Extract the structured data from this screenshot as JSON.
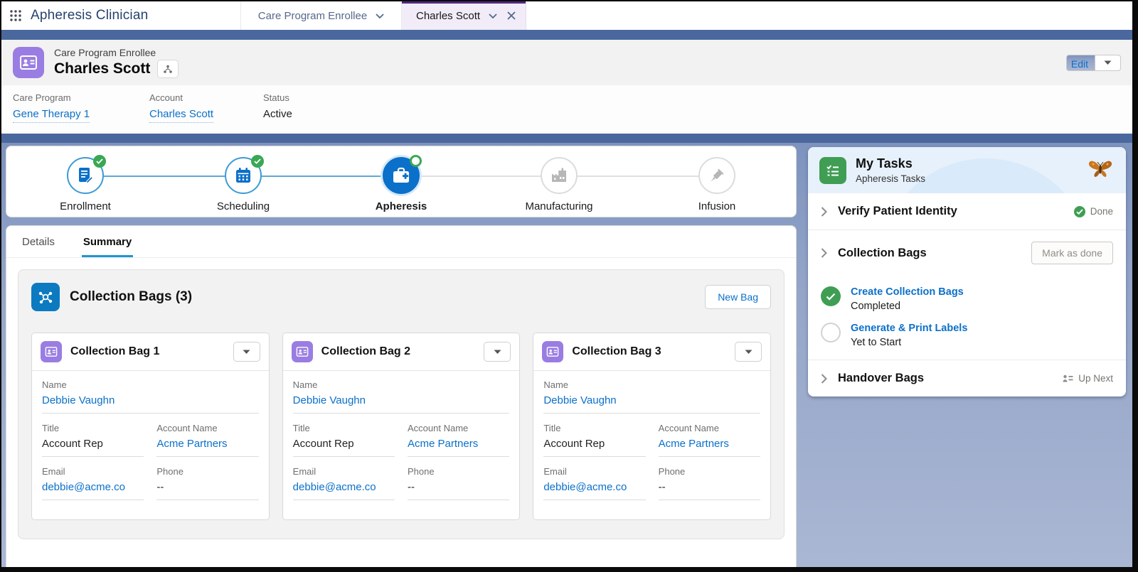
{
  "app": {
    "name": "Apheresis Clinician"
  },
  "nav": {
    "object_tab": "Care Program Enrollee",
    "record_tab": "Charles Scott"
  },
  "header": {
    "entity": "Care Program Enrollee",
    "record_name": "Charles Scott",
    "edit_button": "Edit",
    "fields": [
      {
        "label": "Care Program",
        "value": "Gene Therapy 1"
      },
      {
        "label": "Account",
        "value": "Charles Scott"
      },
      {
        "label": "Status",
        "value": "Active"
      }
    ]
  },
  "path": {
    "stages": [
      {
        "label": "Enrollment",
        "state": "complete",
        "icon": "document-icon"
      },
      {
        "label": "Scheduling",
        "state": "complete",
        "icon": "calendar-icon"
      },
      {
        "label": "Apheresis",
        "state": "current",
        "icon": "first-aid-icon"
      },
      {
        "label": "Manufacturing",
        "state": "upcoming",
        "icon": "factory-icon"
      },
      {
        "label": "Infusion",
        "state": "upcoming",
        "icon": "syringe-icon"
      }
    ]
  },
  "tabs": [
    {
      "label": "Details",
      "active": false
    },
    {
      "label": "Summary",
      "active": true
    }
  ],
  "collection_bags": {
    "title": "Collection Bags (3)",
    "new_bag_button": "New Bag",
    "cards": [
      {
        "title": "Collection Bag 1",
        "name_label": "Name",
        "name": "Debbie Vaughn",
        "title_label": "Title",
        "title_value": "Account Rep",
        "account_label": "Account Name",
        "account": "Acme Partners",
        "email_label": "Email",
        "email": "debbie@acme.co",
        "phone_label": "Phone",
        "phone": "--"
      },
      {
        "title": "Collection Bag 2",
        "name_label": "Name",
        "name": "Debbie Vaughn",
        "title_label": "Title",
        "title_value": "Account Rep",
        "account_label": "Account Name",
        "account": "Acme Partners",
        "email_label": "Email",
        "email": "debbie@acme.co",
        "phone_label": "Phone",
        "phone": "--"
      },
      {
        "title": "Collection Bag 3",
        "name_label": "Name",
        "name": "Debbie Vaughn",
        "title_label": "Title",
        "title_value": "Account Rep",
        "account_label": "Account Name",
        "account": "Acme Partners",
        "email_label": "Email",
        "email": "debbie@acme.co",
        "phone_label": "Phone",
        "phone": "--"
      }
    ]
  },
  "tasks": {
    "title": "My Tasks",
    "subtitle": "Apheresis Tasks",
    "verify": {
      "label": "Verify Patient Identity",
      "status": "Done"
    },
    "collection": {
      "label": "Collection Bags",
      "action": "Mark as done",
      "items": [
        {
          "label": "Create Collection Bags",
          "status": "Completed",
          "state": "complete"
        },
        {
          "label": "Generate & Print Labels",
          "status": "Yet to Start",
          "state": "open"
        }
      ]
    },
    "handover": {
      "label": "Handover Bags",
      "status": "Up Next"
    }
  },
  "colors": {
    "brand_navy": "#25426e",
    "band_blue": "#4a689d",
    "link_blue": "#0b70c9",
    "path_blue": "#0b70c9",
    "success_green": "#3f9e53",
    "accent_purple": "#9a7de2",
    "active_tab_purple": "#53287e",
    "section_icon_blue": "#0b7ac1"
  }
}
